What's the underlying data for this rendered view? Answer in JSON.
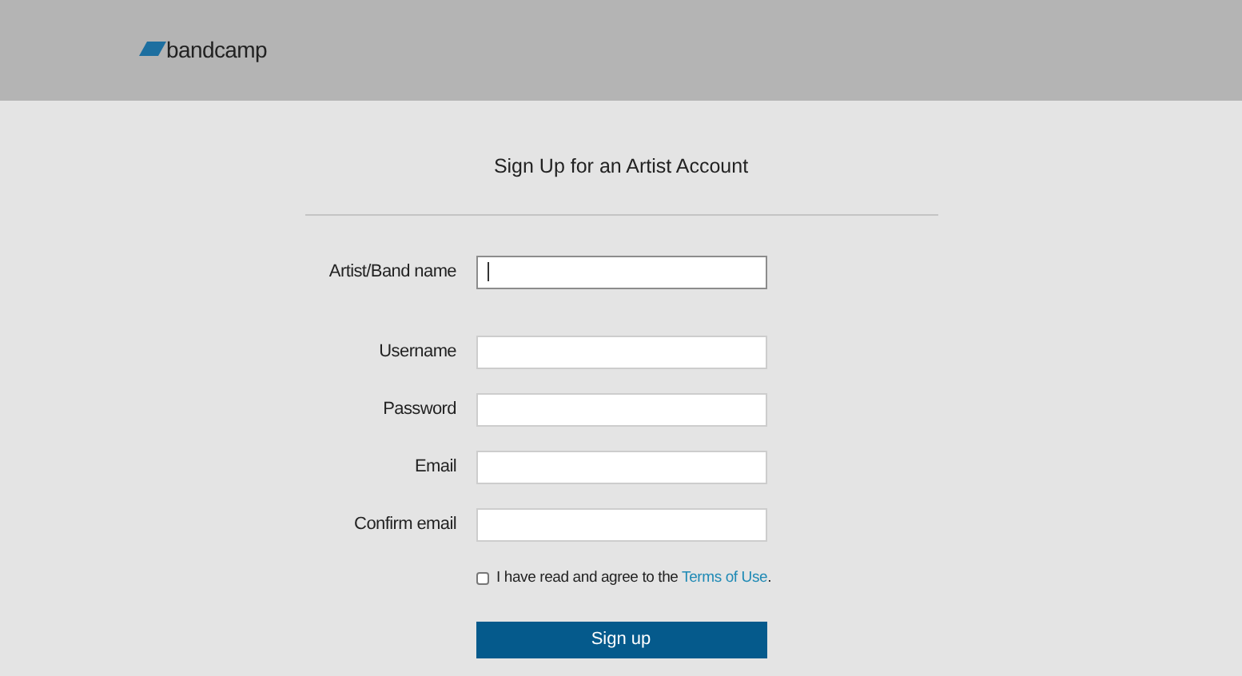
{
  "header": {
    "logo_text": "bandcamp"
  },
  "title": "Sign Up for an Artist Account",
  "fields": [
    {
      "label": "Artist/Band name",
      "focused": true
    },
    {
      "label": "Username",
      "focused": false
    },
    {
      "label": "Password",
      "focused": false
    },
    {
      "label": "Email",
      "focused": false
    },
    {
      "label": "Confirm email",
      "focused": false
    }
  ],
  "agreement": {
    "checked": false,
    "text": "I have read and agree to the ",
    "link": "Terms of Use",
    "after": "."
  },
  "submit_button": "Sign up"
}
